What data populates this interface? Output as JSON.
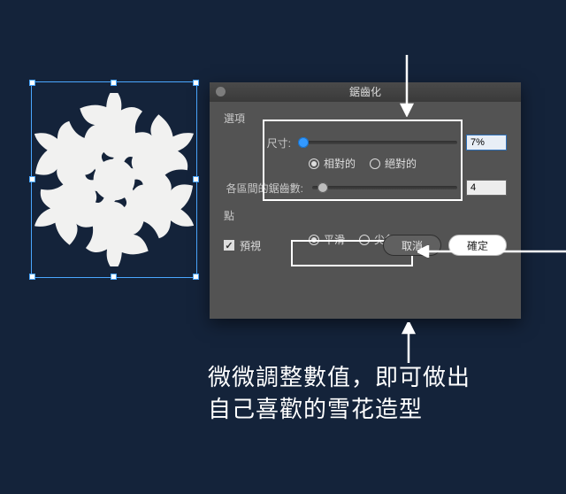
{
  "dialog": {
    "title": "鋸齒化",
    "section_options": "選項",
    "section_points": "點",
    "size_label": "尺寸:",
    "size_value": "7%",
    "size_mode": {
      "relative": "相對的",
      "absolute": "絕對的",
      "selected": "relative"
    },
    "ridges_label": "各區間的鋸齒數:",
    "ridges_value": "4",
    "point_mode": {
      "smooth": "平滑",
      "corner": "尖角",
      "selected": "smooth"
    },
    "preview_label": "預視",
    "cancel": "取消",
    "ok": "確定"
  },
  "caption": {
    "line1": "微微調整數值，即可做出",
    "line2": "自己喜歡的雪花造型"
  }
}
